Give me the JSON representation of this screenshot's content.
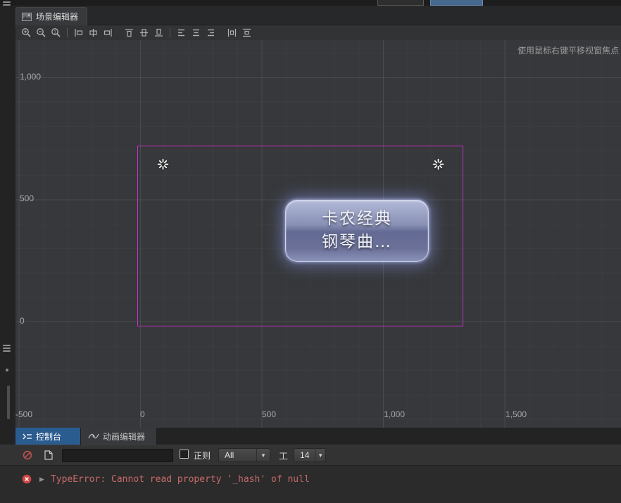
{
  "scene_editor": {
    "tab_label": "场景编辑器",
    "hint": "使用鼠标右键平移视窗焦点",
    "y_axis_labels": [
      "1,000",
      "500",
      "0"
    ],
    "x_axis_labels": [
      "-500",
      "0",
      "500",
      "1,000",
      "1,500"
    ],
    "node_button": {
      "line1": "卡农经典",
      "line2": "钢琴曲…"
    }
  },
  "bottom_panel": {
    "console_tab": "控制台",
    "animation_tab": "动画编辑器"
  },
  "console": {
    "search_value": "",
    "regex_label": "正则",
    "filter_value": "All",
    "font_size_icon": "工",
    "font_size_value": "14",
    "dropdown_arrow": "▼",
    "error_expander": "▶",
    "error_message": "TypeError: Cannot read property '_hash' of null"
  },
  "icons": {
    "zoom_reset_digit": "1"
  },
  "colors": {
    "scene_bounds": "#c92fc9",
    "console_tab_active": "#2b5c8f",
    "error_text": "#c76a6a"
  }
}
